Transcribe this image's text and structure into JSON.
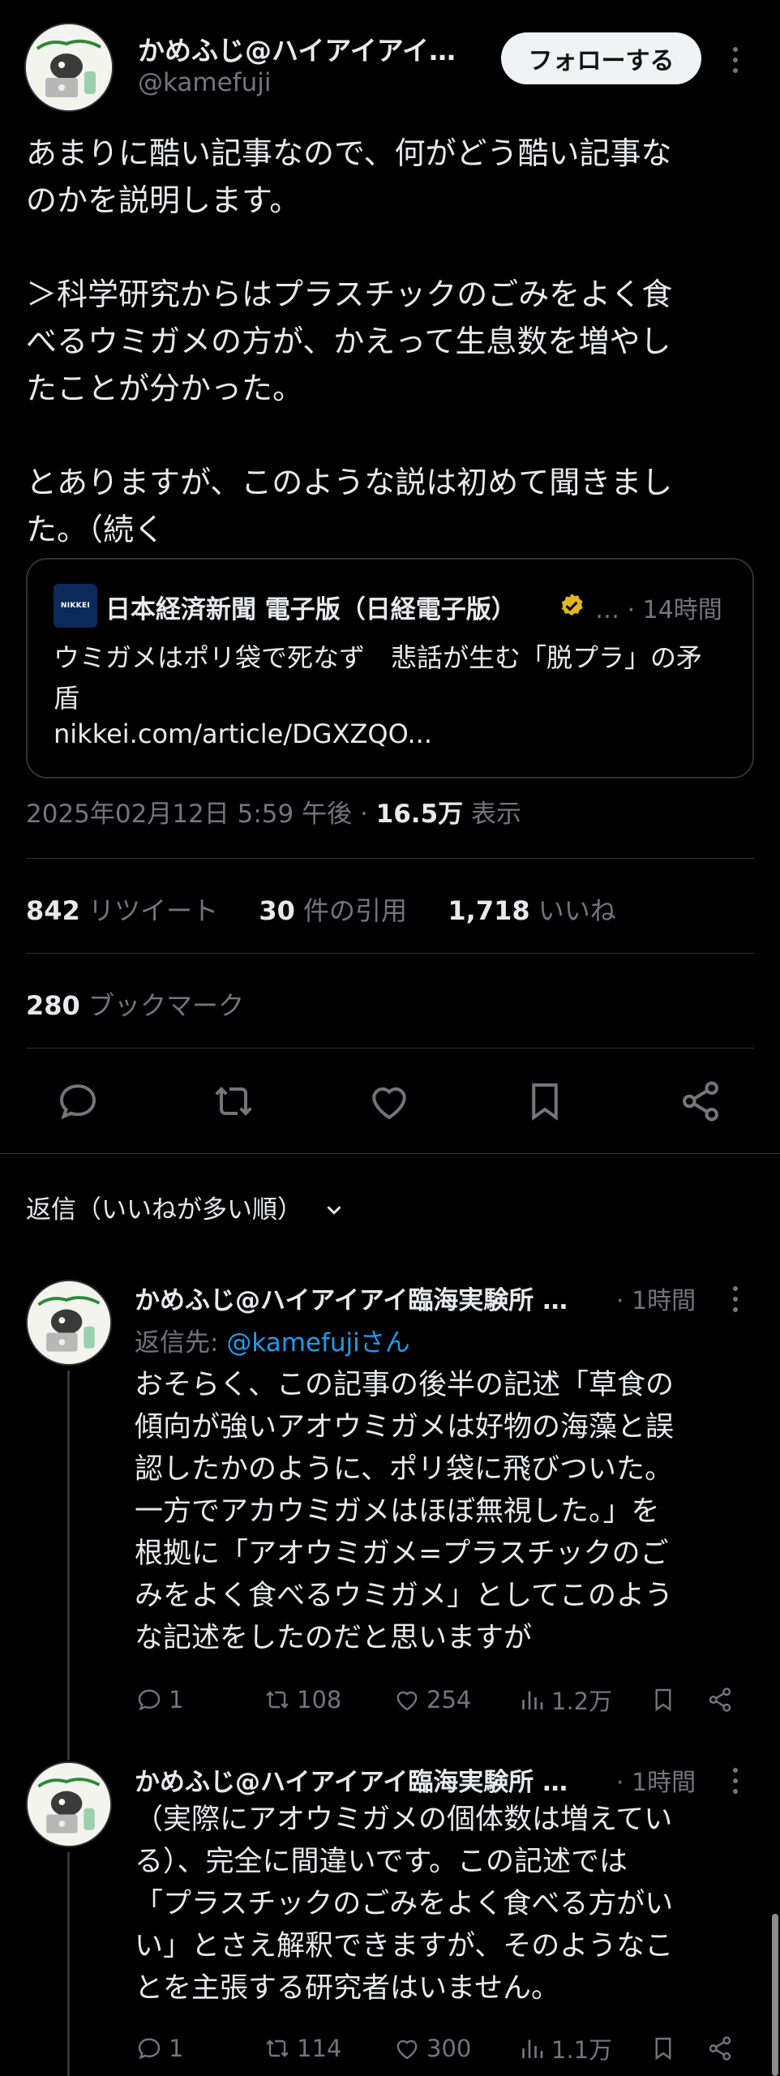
{
  "author": {
    "display_name": "かめふじ@ハイアイアイ…",
    "handle": "@kamefuji",
    "follow_label": "フォローする"
  },
  "tweet": {
    "text": "あまりに酷い記事なので、何がどう酷い記事な\nのかを説明します。\n\n＞科学研究からはプラスチックのごみをよく食\nべるウミガメの方が、かえって生息数を増やし\nたことが分かった。\n\nとありますが、このような説は初めて聞きまし\nた。（続く",
    "card": {
      "logo_text": "NIKKEI",
      "source": "日本経済新聞 電子版（日経電子版）",
      "ellipsis": "…",
      "time": "· 14時間",
      "title": "ウミガメはポリ袋で死なず　悲話が生む「脱プラ」の矛盾",
      "url": "nikkei.com/article/DGXZQO..."
    },
    "timestamp": "2025年02月12日 5:59 午後 · ",
    "views_count": "16.5万",
    "views_label": " 表示",
    "retweets_count": "842",
    "retweets_label": " リツイート",
    "quotes_count": "30",
    "quotes_label": " 件の引用",
    "likes_count": "1,718",
    "likes_label": " いいね",
    "bookmarks_count": "280",
    "bookmarks_label": " ブックマーク"
  },
  "replies_sort": {
    "label": "返信（いいねが多い順）"
  },
  "replies": [
    {
      "name": "かめふじ@ハイアイアイ臨海実験所 …",
      "time": "· 1時間",
      "reply_to_prefix": "返信先: ",
      "reply_to_mention": "@kamefujiさん",
      "text": "おそらく、この記事の後半の記述「草食の\n傾向が強いアオウミガメは好物の海藻と誤\n認したかのように、ポリ袋に飛びついた。\n一方でアカウミガメはほぼ無視した。」を\n根拠に「アオウミガメ=プラスチックのご\nみをよく食べるウミガメ」としてこのよう\nな記述をしたのだと思いますが",
      "replies": "1",
      "retweets": "108",
      "likes": "254",
      "views": "1.2万"
    },
    {
      "name": "かめふじ@ハイアイアイ臨海実験所 …",
      "time": "· 1時間",
      "text": "（実際にアオウミガメの個体数は増えてい\nる）、完全に間違いです。この記述では\n「プラスチックのごみをよく食べる方がい\nい」とさえ解釈できますが、そのようなこ\nとを主張する研究者はいません。",
      "replies": "1",
      "retweets": "114",
      "likes": "300",
      "views": "1.1万"
    }
  ],
  "colors": {
    "background": "#000000",
    "text": "#e7e9ea",
    "secondary": "#71767b",
    "link": "#1d9bf0",
    "border": "#2f3336",
    "verified": "#e2b719"
  }
}
